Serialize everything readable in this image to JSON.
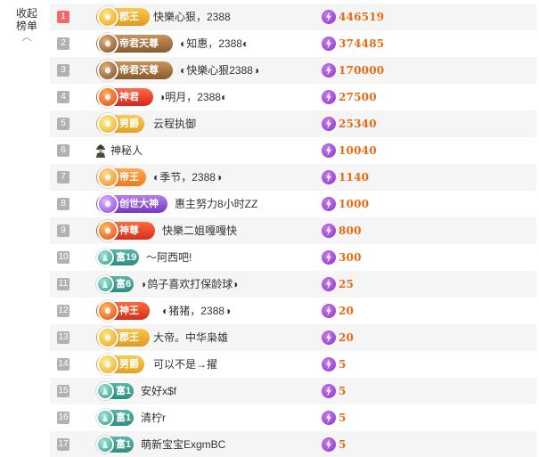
{
  "sidebar": {
    "collapse_label": "收起榜单"
  },
  "help_icon_text": "?",
  "colors": {
    "accent": "#e86a14",
    "rank_top": "#f06a6a",
    "rank_default": "#b2b2b2"
  },
  "rows": [
    {
      "rank": "1",
      "badge": "郡王",
      "badge_type": "junwang",
      "name": "快樂心狠，2388",
      "points": "446519"
    },
    {
      "rank": "2",
      "badge": "帝君天尊",
      "badge_type": "dijun",
      "name": "◐知惠，2388◐",
      "points": "374485"
    },
    {
      "rank": "3",
      "badge": "帝君天尊",
      "badge_type": "dijun",
      "name": "◐快樂心狠2388◑",
      "points": "170000"
    },
    {
      "rank": "4",
      "badge": "神君",
      "badge_type": "shenjun",
      "name": "◑明月，2388◐",
      "points": "27500"
    },
    {
      "rank": "5",
      "badge": "男爵",
      "badge_type": "nanjue",
      "name": "云程执御",
      "points": "25340"
    },
    {
      "rank": "6",
      "badge": "",
      "badge_type": "mystery",
      "name": "神秘人",
      "points": "10040"
    },
    {
      "rank": "7",
      "badge": "帝王",
      "badge_type": "diwang",
      "name": "◐季节，2388◑",
      "points": "1140"
    },
    {
      "rank": "8",
      "badge": "创世大神",
      "badge_type": "chuangshi",
      "name": "惠主努力8小时ZZ",
      "points": "1000"
    },
    {
      "rank": "9",
      "badge": "神尊",
      "badge_type": "shenzun",
      "name": "快樂二姐嘎嘎快",
      "points": "800"
    },
    {
      "rank": "10",
      "badge": "富19",
      "badge_type": "fu19",
      "name": "～阿西吧!",
      "points": "300"
    },
    {
      "rank": "11",
      "badge": "富6",
      "badge_type": "fu6",
      "name": "◗鸽子喜欢打保龄球◗",
      "points": "25"
    },
    {
      "rank": "12",
      "badge": "神王",
      "badge_type": "shenwang",
      "name": "◐猪猪，2388◑",
      "points": "20"
    },
    {
      "rank": "13",
      "badge": "郡王",
      "badge_type": "junwang",
      "name": "大帝。中华枭雄",
      "points": "20"
    },
    {
      "rank": "14",
      "badge": "男爵",
      "badge_type": "nanjue",
      "name": "可以不是→擢",
      "points": "5"
    },
    {
      "rank": "15",
      "badge": "富1",
      "badge_type": "fu1",
      "name": "安好x$f",
      "points": "5"
    },
    {
      "rank": "16",
      "badge": "富1",
      "badge_type": "fu1",
      "name": "清柠r",
      "points": "5"
    },
    {
      "rank": "17",
      "badge": "富1",
      "badge_type": "fu1",
      "name": "萌新宝宝ExgmBC",
      "points": "5"
    }
  ]
}
